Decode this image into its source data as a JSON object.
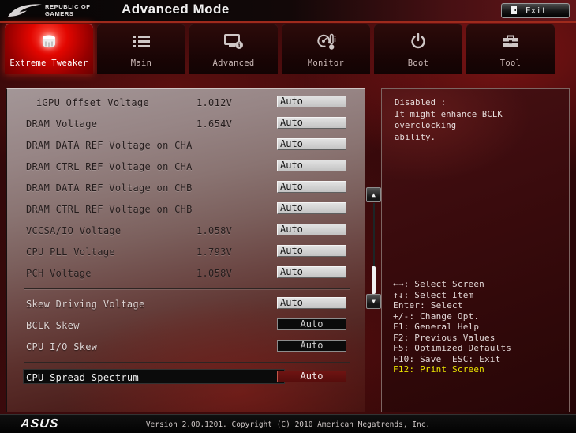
{
  "header": {
    "brand_line1": "REPUBLIC OF",
    "brand_line2": "GAMERS",
    "title": "Advanced Mode",
    "exit_label": "Exit",
    "logo_icon": "rog-eye-logo",
    "exit_icon": "exit-door-icon"
  },
  "tabs": [
    {
      "label": "Extreme Tweaker",
      "icon": "tweaker-knob-icon",
      "active": true
    },
    {
      "label": "Main",
      "icon": "list-icon",
      "active": false
    },
    {
      "label": "Advanced",
      "icon": "monitor-info-icon",
      "active": false
    },
    {
      "label": "Monitor",
      "icon": "gauge-thermometer-icon",
      "active": false
    },
    {
      "label": "Boot",
      "icon": "power-icon",
      "active": false
    },
    {
      "label": "Tool",
      "icon": "toolbox-icon",
      "active": false
    }
  ],
  "settings": {
    "groups": [
      [
        {
          "label": "iGPU Offset Voltage",
          "indent": true,
          "reading": "1.012V",
          "value": "Auto",
          "box": "light"
        },
        {
          "label": "DRAM Voltage",
          "reading": "1.654V",
          "value": "Auto",
          "box": "light"
        },
        {
          "label": "DRAM DATA REF Voltage on CHA",
          "reading": "",
          "value": "Auto",
          "box": "light"
        },
        {
          "label": "DRAM CTRL REF Voltage on CHA",
          "reading": "",
          "value": "Auto",
          "box": "light"
        },
        {
          "label": "DRAM DATA REF Voltage on CHB",
          "reading": "",
          "value": "Auto",
          "box": "light"
        },
        {
          "label": "DRAM CTRL REF Voltage on CHB",
          "reading": "",
          "value": "Auto",
          "box": "light"
        },
        {
          "label": "VCCSA/IO Voltage",
          "reading": "1.058V",
          "value": "Auto",
          "box": "light"
        },
        {
          "label": "CPU PLL Voltage",
          "reading": "1.793V",
          "value": "Auto",
          "box": "light"
        },
        {
          "label": "PCH Voltage",
          "reading": "1.058V",
          "value": "Auto",
          "box": "light"
        }
      ],
      [
        {
          "label": "Skew Driving Voltage",
          "reading": "",
          "value": "Auto",
          "box": "light"
        },
        {
          "label": "BCLK Skew",
          "reading": "",
          "value": "Auto",
          "box": "dark"
        },
        {
          "label": "CPU I/O Skew",
          "reading": "",
          "value": "Auto",
          "box": "dark"
        }
      ],
      [
        {
          "label": "CPU Spread Spectrum",
          "reading": "",
          "value": "Auto",
          "box": "red",
          "selected": true
        }
      ]
    ]
  },
  "help": {
    "lines": [
      "Disabled :",
      "It might enhance BCLK overclocking",
      "ability."
    ]
  },
  "key_legend": [
    {
      "text": "←→: Select Screen",
      "highlight": false
    },
    {
      "text": "↑↓: Select Item",
      "highlight": false
    },
    {
      "text": "Enter: Select",
      "highlight": false
    },
    {
      "text": "+/-: Change Opt.",
      "highlight": false
    },
    {
      "text": "F1: General Help",
      "highlight": false
    },
    {
      "text": "F2: Previous Values",
      "highlight": false
    },
    {
      "text": "F5: Optimized Defaults",
      "highlight": false
    },
    {
      "text": "F10: Save  ESC: Exit",
      "highlight": false
    },
    {
      "text": "F12: Print Screen",
      "highlight": true
    }
  ],
  "footer": {
    "brand": "ASUS",
    "version": "Version 2.00.1201. Copyright (C) 2010 American Megatrends, Inc."
  },
  "colors": {
    "accent_red": "#9e2a1c",
    "active_tab_red": "#e20600",
    "panel_dark_red": "#3a0b0d",
    "legend_highlight_yellow": "#e9e400",
    "value_box_gray": "#d2d2d2",
    "selected_value_red": "#6e1412"
  }
}
